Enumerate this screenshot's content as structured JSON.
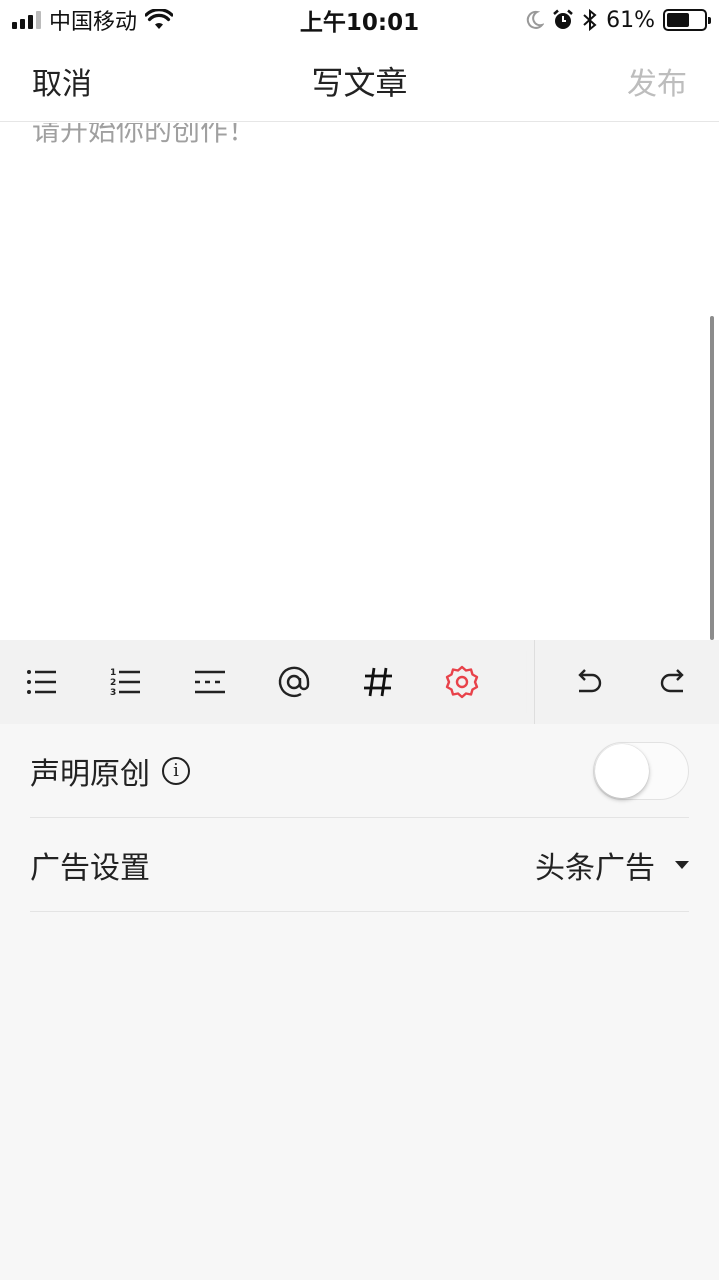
{
  "status_bar": {
    "carrier": "中国移动",
    "time": "上午10:01",
    "battery_percent": "61%",
    "battery_level": 0.61,
    "icons": [
      "signal-icon",
      "wifi-icon",
      "moon-icon",
      "alarm-icon",
      "bluetooth-icon",
      "battery-icon"
    ]
  },
  "nav": {
    "cancel_label": "取消",
    "title": "写文章",
    "publish_label": "发布"
  },
  "editor": {
    "placeholder": "请开始你的创作！"
  },
  "toolbar": {
    "tools": [
      "bullet-list-icon",
      "numbered-list-icon",
      "divider-icon",
      "at-mention-icon",
      "hashtag-icon",
      "settings-icon",
      "undo-icon",
      "redo-icon"
    ],
    "active_color": "#e8424a"
  },
  "settings": {
    "original_label": "声明原创",
    "original_enabled": false,
    "ad_label": "广告设置",
    "ad_value": "头条广告"
  }
}
